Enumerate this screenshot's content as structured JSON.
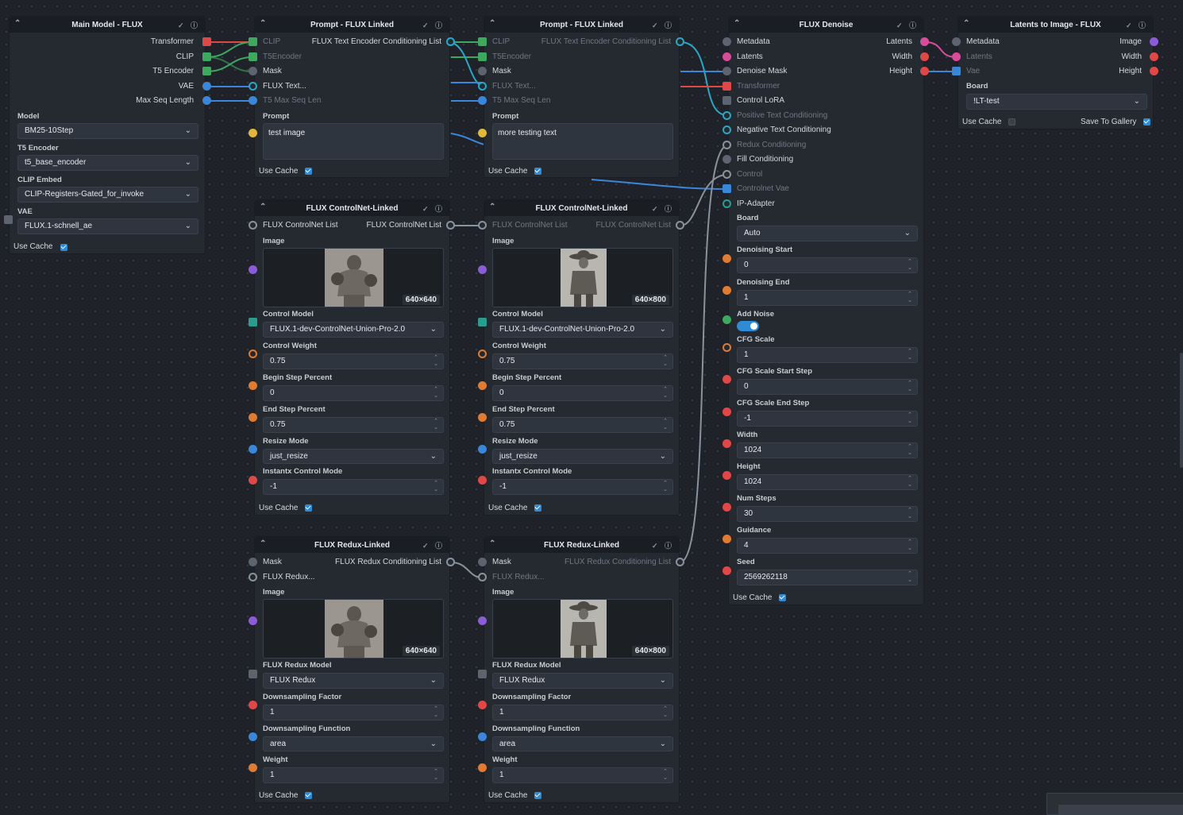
{
  "colors": {
    "transformer": "#e04848",
    "clip": "#3fa85f",
    "vae": "#3a86d8",
    "integer": "#e07b34",
    "float": "#e07b34",
    "string": "#e0b83c",
    "image": "#8c5cd6",
    "model": "#5d6470",
    "conditioning": "#29a8c6",
    "latents": "#d94b9b",
    "board": "#3fa85f",
    "redux": "#8a929e",
    "controlnet_model": "#2a9d8f"
  },
  "nodes": {
    "main_model": {
      "title": "Main Model - FLUX",
      "outputs": [
        "Transformer",
        "CLIP",
        "T5 Encoder",
        "VAE",
        "Max Seq Length"
      ],
      "model_label": "Model",
      "model_value": "BM25-10Step",
      "t5_label": "T5 Encoder",
      "t5_value": "t5_base_encoder",
      "clip_label": "CLIP Embed",
      "clip_value": "CLIP-Registers-Gated_for_invoke",
      "vae_label": "VAE",
      "vae_value": "FLUX.1-schnell_ae",
      "use_cache": "Use Cache"
    },
    "prompt1": {
      "title": "Prompt - FLUX Linked",
      "inputs": [
        "CLIP",
        "T5Encoder",
        "Mask",
        "FLUX Text...",
        "T5 Max Seq Len"
      ],
      "output": "FLUX Text Encoder Conditioning List",
      "prompt_label": "Prompt",
      "prompt_value": "test image",
      "use_cache": "Use Cache"
    },
    "prompt2": {
      "title": "Prompt - FLUX Linked",
      "inputs": [
        "CLIP",
        "T5Encoder",
        "Mask",
        "FLUX Text...",
        "T5 Max Seq Len"
      ],
      "output": "FLUX Text Encoder Conditioning List",
      "prompt_label": "Prompt",
      "prompt_value": "more testing text",
      "use_cache": "Use Cache"
    },
    "denoise": {
      "title": "FLUX Denoise",
      "inputs": [
        "Metadata",
        "Latents",
        "Denoise Mask",
        "Transformer",
        "Control LoRA",
        "Positive Text Conditioning",
        "Negative Text Conditioning",
        "Redux Conditioning",
        "Fill Conditioning",
        "Control",
        "Controlnet Vae",
        "IP-Adapter"
      ],
      "outputs": [
        "Latents",
        "Width",
        "Height"
      ],
      "board_label": "Board",
      "board_value": "Auto",
      "fields": [
        {
          "label": "Denoising Start",
          "value": "0"
        },
        {
          "label": "Denoising End",
          "value": "1"
        },
        {
          "label": "CFG Scale",
          "value": "1"
        },
        {
          "label": "CFG Scale Start Step",
          "value": "0"
        },
        {
          "label": "CFG Scale End Step",
          "value": "-1"
        },
        {
          "label": "Width",
          "value": "1024"
        },
        {
          "label": "Height",
          "value": "1024"
        },
        {
          "label": "Num Steps",
          "value": "30"
        },
        {
          "label": "Guidance",
          "value": "4"
        },
        {
          "label": "Seed",
          "value": "2569262118"
        }
      ],
      "add_noise_label": "Add Noise",
      "use_cache": "Use Cache"
    },
    "l2i": {
      "title": "Latents to Image - FLUX",
      "inputs": [
        "Metadata",
        "Latents",
        "Vae"
      ],
      "outputs": [
        "Image",
        "Width",
        "Height"
      ],
      "board_label": "Board",
      "board_value": "!LT-test",
      "use_cache": "Use Cache",
      "save_to_gallery": "Save To Gallery"
    },
    "cn1": {
      "title": "FLUX ControlNet-Linked",
      "input": "FLUX ControlNet List",
      "output": "FLUX ControlNet List",
      "image_label": "Image",
      "image_dims": "640×640",
      "control_model_label": "Control Model",
      "control_model_value": "FLUX.1-dev-ControlNet-Union-Pro-2.0",
      "control_weight_label": "Control Weight",
      "control_weight_value": "0.75",
      "begin_label": "Begin Step Percent",
      "begin_value": "0",
      "end_label": "End Step Percent",
      "end_value": "0.75",
      "resize_label": "Resize Mode",
      "resize_value": "just_resize",
      "instantx_label": "Instantx Control Mode",
      "instantx_value": "-1",
      "use_cache": "Use Cache"
    },
    "cn2": {
      "title": "FLUX ControlNet-Linked",
      "input": "FLUX ControlNet List",
      "output": "FLUX ControlNet List",
      "image_label": "Image",
      "image_dims": "640×800",
      "control_model_label": "Control Model",
      "control_model_value": "FLUX.1-dev-ControlNet-Union-Pro-2.0",
      "control_weight_label": "Control Weight",
      "control_weight_value": "0.75",
      "begin_label": "Begin Step Percent",
      "begin_value": "0",
      "end_label": "End Step Percent",
      "end_value": "0.75",
      "resize_label": "Resize Mode",
      "resize_value": "just_resize",
      "instantx_label": "Instantx Control Mode",
      "instantx_value": "-1",
      "use_cache": "Use Cache"
    },
    "redux1": {
      "title": "FLUX Redux-Linked",
      "inputs": [
        "Mask",
        "FLUX Redux..."
      ],
      "output": "FLUX Redux Conditioning List",
      "image_label": "Image",
      "image_dims": "640×640",
      "model_label": "FLUX Redux Model",
      "model_value": "FLUX Redux",
      "dsf_label": "Downsampling Factor",
      "dsf_value": "1",
      "dsfn_label": "Downsampling Function",
      "dsfn_value": "area",
      "weight_label": "Weight",
      "weight_value": "1",
      "use_cache": "Use Cache"
    },
    "redux2": {
      "title": "FLUX Redux-Linked",
      "inputs": [
        "Mask",
        "FLUX Redux..."
      ],
      "output": "FLUX Redux Conditioning List",
      "image_label": "Image",
      "image_dims": "640×800",
      "model_label": "FLUX Redux Model",
      "model_value": "FLUX Redux",
      "dsf_label": "Downsampling Factor",
      "dsf_value": "1",
      "dsfn_label": "Downsampling Function",
      "dsfn_value": "area",
      "weight_label": "Weight",
      "weight_value": "1",
      "use_cache": "Use Cache"
    }
  }
}
